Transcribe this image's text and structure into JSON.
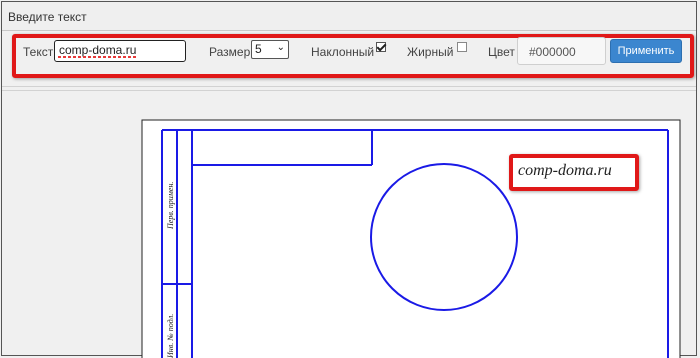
{
  "dialog": {
    "title": "Введите текст"
  },
  "toolbar": {
    "text_label": "Текст",
    "text_value": "comp-doma.ru",
    "size_label": "Размер",
    "size_value": "5",
    "italic_label": "Наклонный",
    "italic_checked": true,
    "bold_label": "Жирный",
    "bold_checked": false,
    "color_label": "Цвет",
    "color_value": "#000000",
    "apply_label": "Применить"
  },
  "drawing": {
    "stamp_text_1": "Перв. примен.",
    "stamp_text_2": "Инв. № подл.",
    "sample_text": "comp-doma.ru",
    "line_color": "#1a1ae6"
  },
  "colors": {
    "highlight": "#e01818",
    "accent": "#3b86cf"
  }
}
